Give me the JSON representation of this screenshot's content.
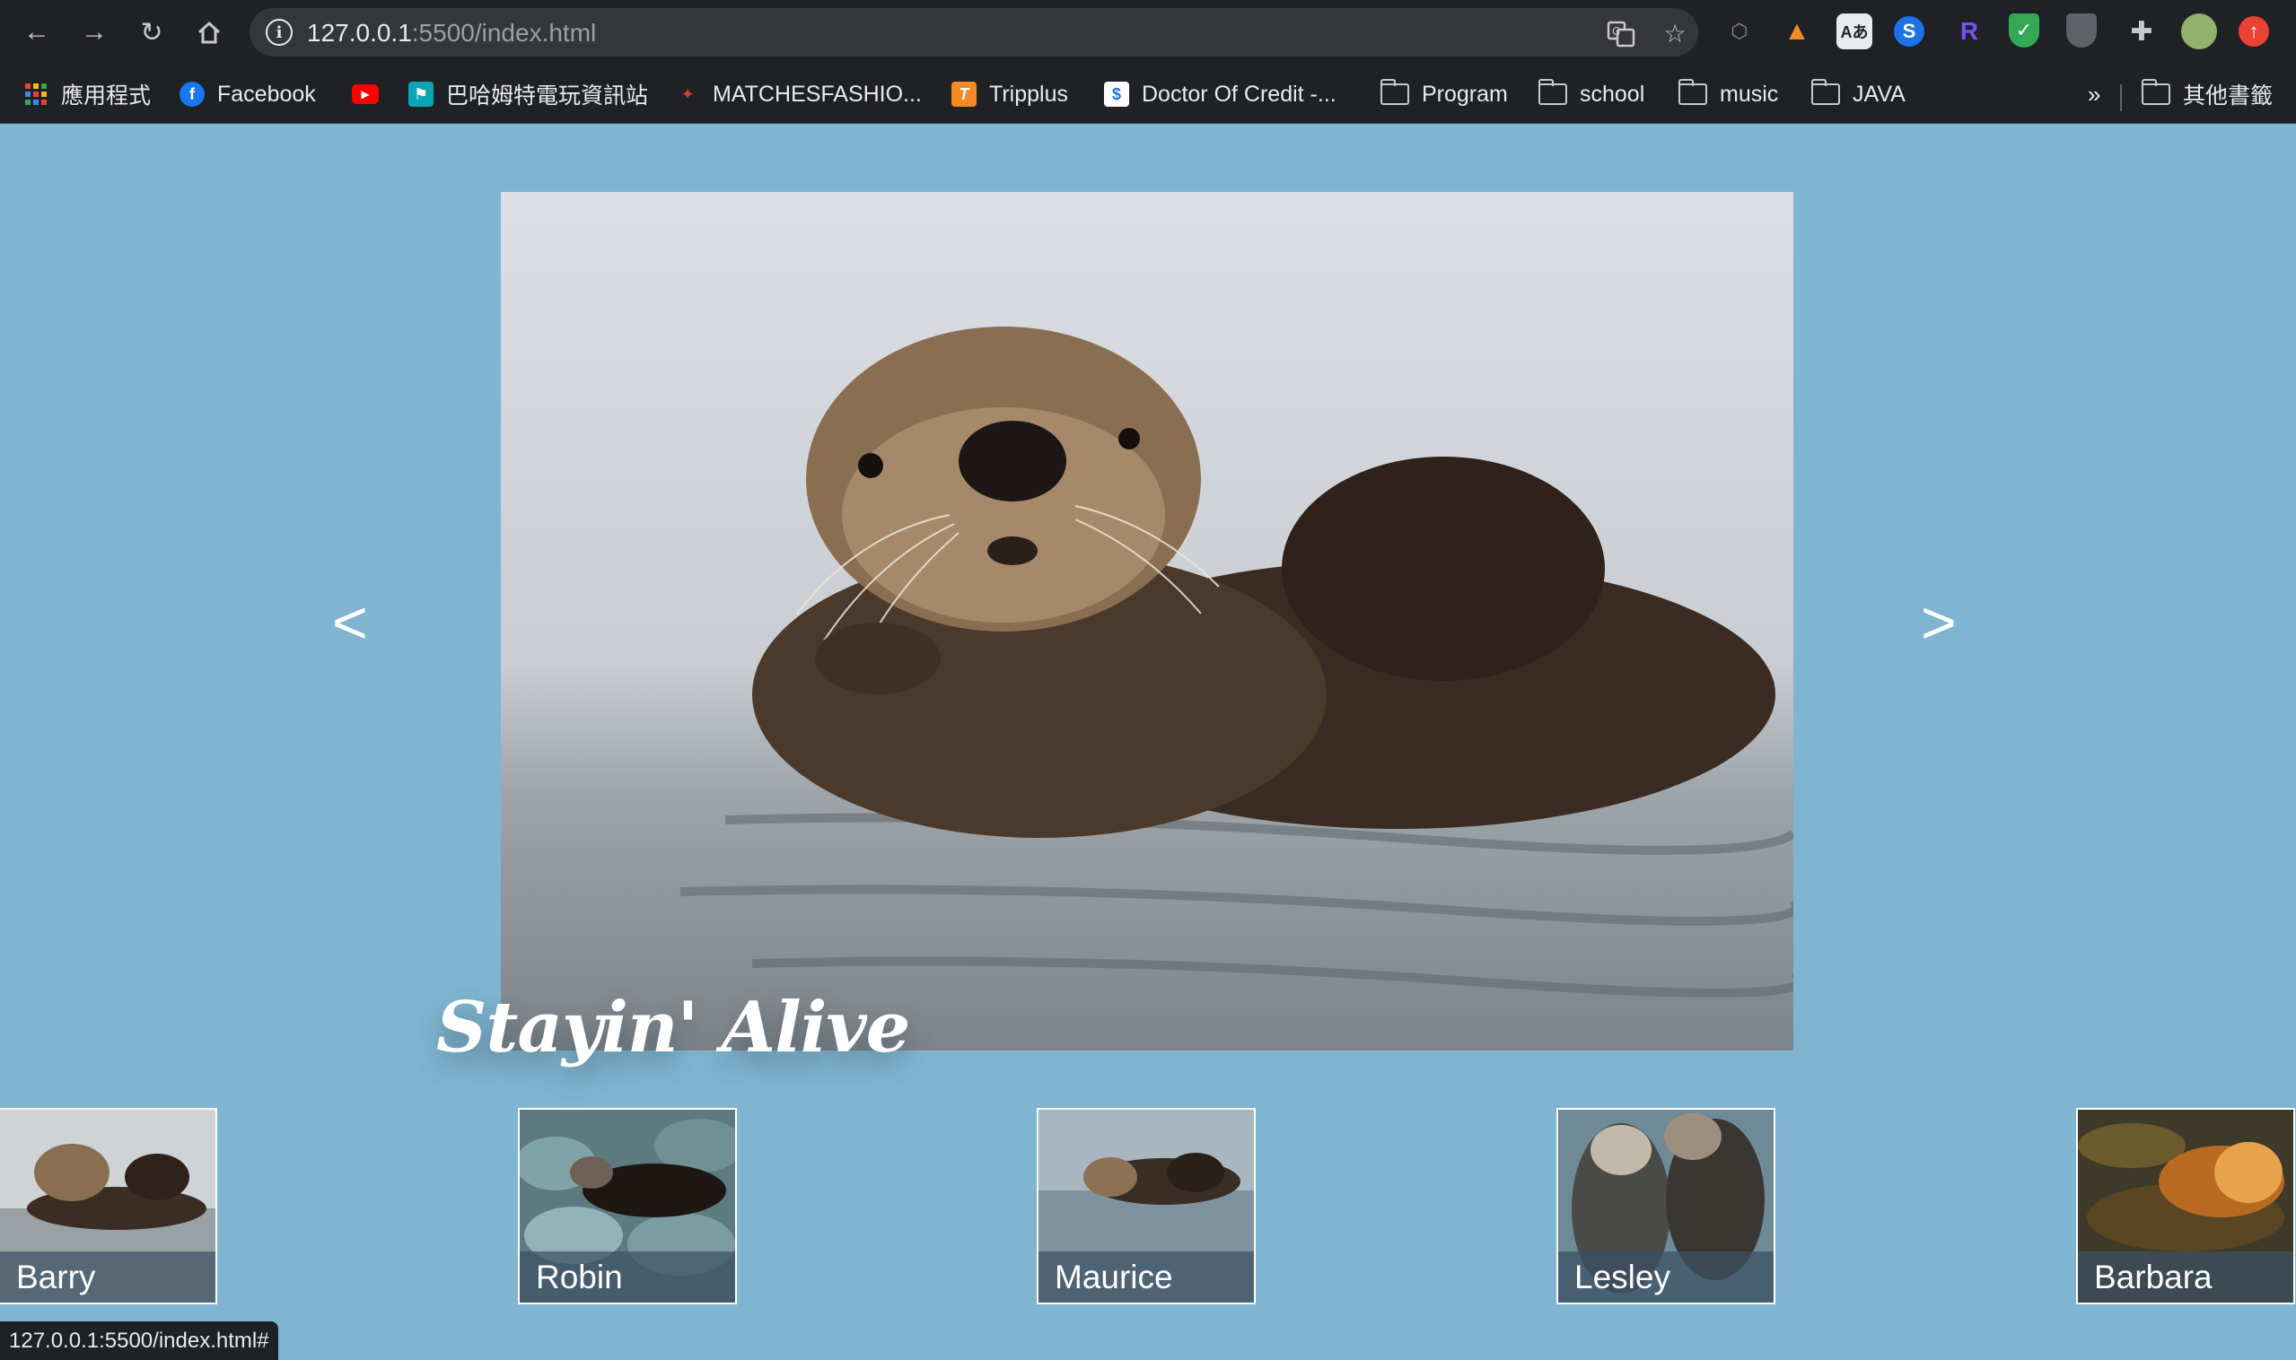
{
  "browser": {
    "url_host": "127.0.0.1",
    "url_rest": ":5500/index.html",
    "bookmarks": [
      {
        "label": "應用程式",
        "icon": "apps-grid-icon"
      },
      {
        "label": "Facebook",
        "icon": "facebook-icon"
      },
      {
        "label": "",
        "icon": "youtube-icon"
      },
      {
        "label": "巴哈姆特電玩資訊站",
        "icon": "bahamut-icon"
      },
      {
        "label": "MATCHESFASHIO...",
        "icon": "matchesfashion-icon"
      },
      {
        "label": "Tripplus",
        "icon": "tripplus-icon"
      },
      {
        "label": "Doctor Of Credit -...",
        "icon": "doctor-of-credit-icon"
      },
      {
        "label": "Program",
        "icon": "folder-icon"
      },
      {
        "label": "school",
        "icon": "folder-icon"
      },
      {
        "label": "music",
        "icon": "folder-icon"
      },
      {
        "label": "JAVA",
        "icon": "folder-icon"
      }
    ],
    "overflow_label": "»",
    "other_bookmarks_label": "其他書籤",
    "status_url": "127.0.0.1:5500/index.html#"
  },
  "gallery": {
    "prev_label": "<",
    "next_label": ">",
    "caption": "Stayin' Alive",
    "thumbnails": [
      {
        "label": "Barry"
      },
      {
        "label": "Robin"
      },
      {
        "label": "Maurice"
      },
      {
        "label": "Lesley"
      },
      {
        "label": "Barbara"
      }
    ]
  },
  "colors": {
    "page_background": "#7fb5d0",
    "chrome_background": "#202124",
    "thumbnail_label_background": "#3c5064"
  }
}
